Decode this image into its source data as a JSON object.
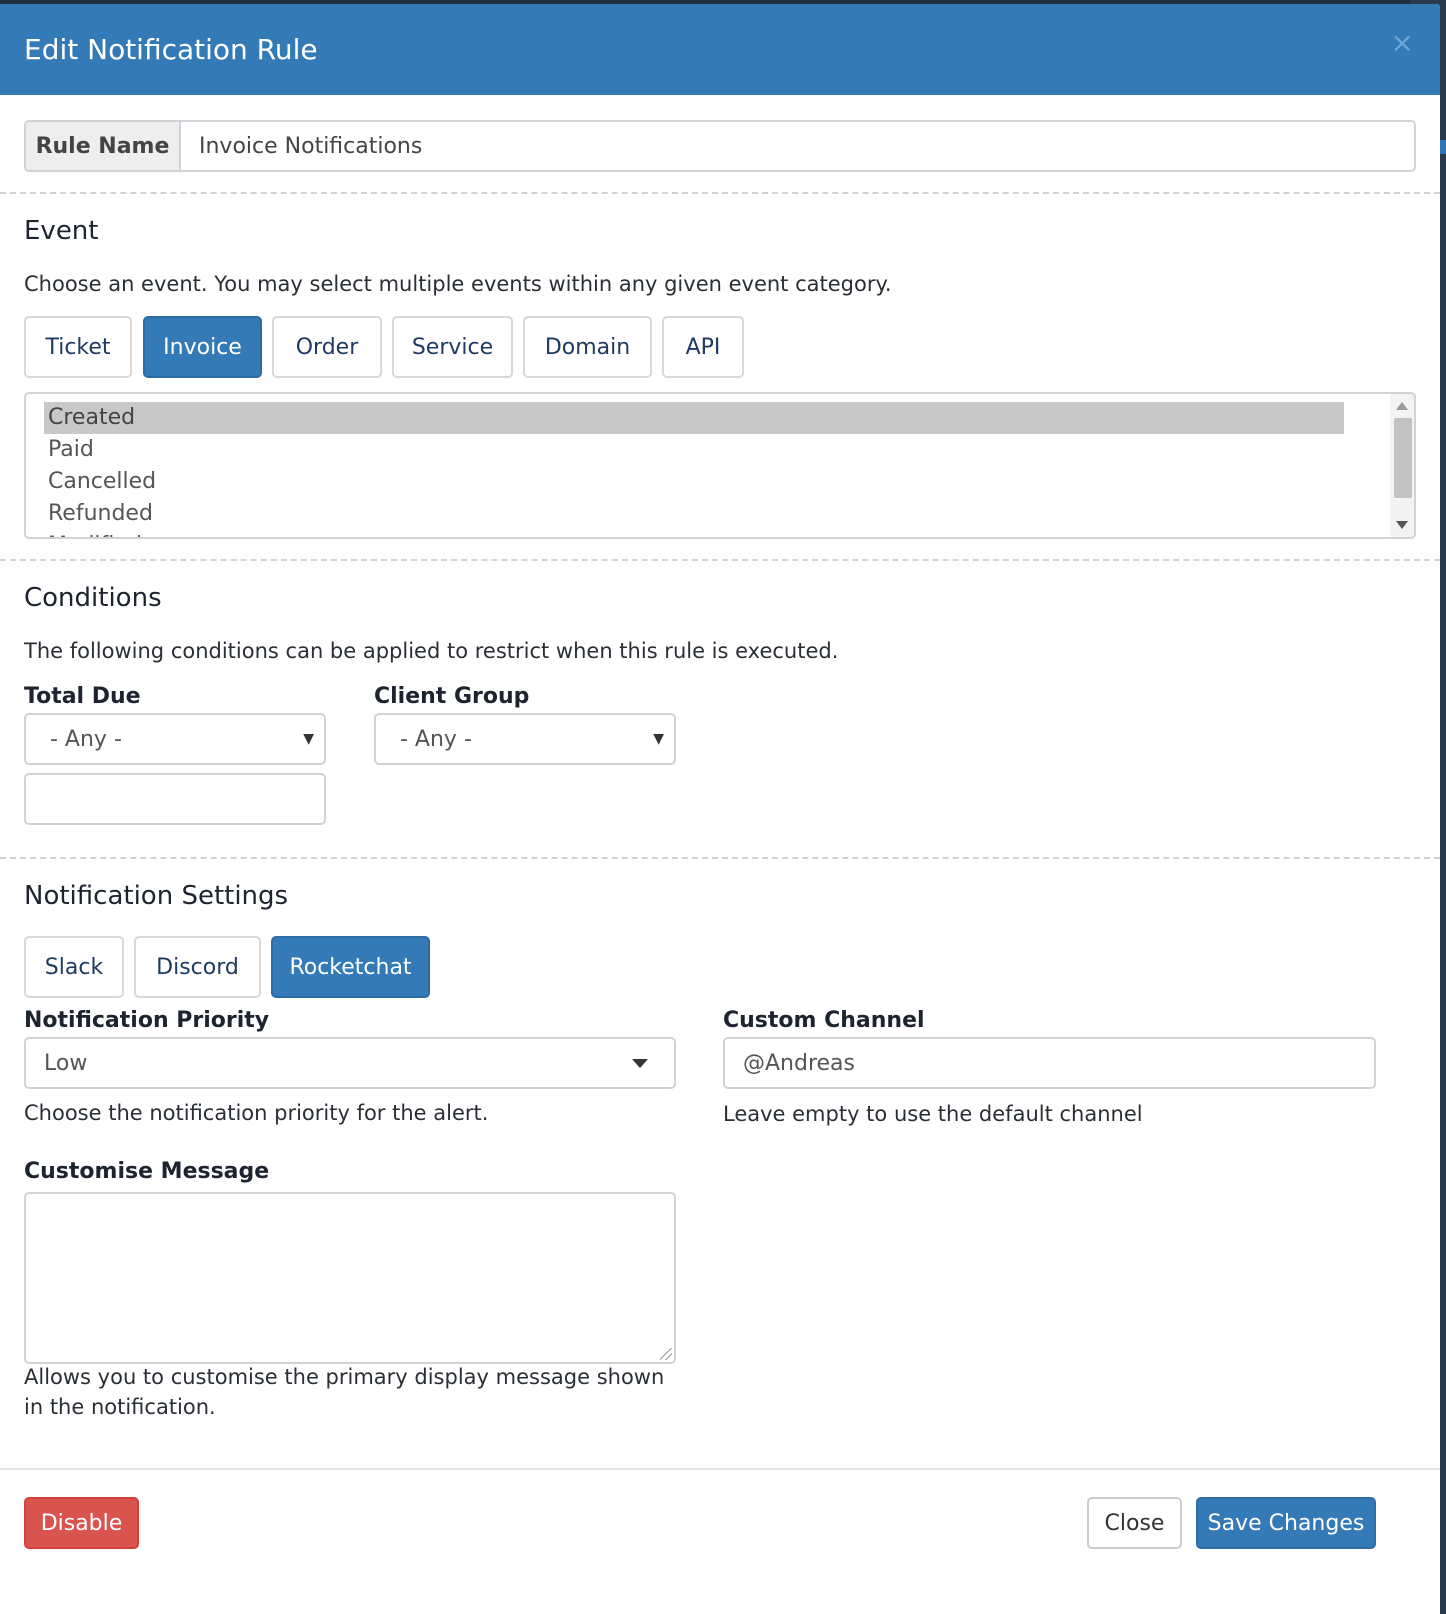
{
  "modal": {
    "title": "Edit Notification Rule",
    "close_symbol": "×"
  },
  "rule_name": {
    "label": "Rule Name",
    "value": "Invoice Notifications"
  },
  "event": {
    "title": "Event",
    "description": "Choose an event. You may select multiple events within any given event category.",
    "categories": [
      {
        "label": "Ticket",
        "active": false
      },
      {
        "label": "Invoice",
        "active": true
      },
      {
        "label": "Order",
        "active": false
      },
      {
        "label": "Service",
        "active": false
      },
      {
        "label": "Domain",
        "active": false
      },
      {
        "label": "API",
        "active": false
      }
    ],
    "items": [
      {
        "label": "Created",
        "selected": true
      },
      {
        "label": "Paid",
        "selected": false
      },
      {
        "label": "Cancelled",
        "selected": false
      },
      {
        "label": "Refunded",
        "selected": false
      },
      {
        "label": "Modified",
        "selected": false
      }
    ]
  },
  "conditions": {
    "title": "Conditions",
    "description": "The following conditions can be applied to restrict when this rule is executed.",
    "total_due": {
      "label": "Total Due",
      "selected": "- Any -",
      "value": ""
    },
    "client_group": {
      "label": "Client Group",
      "selected": "- Any -"
    }
  },
  "notification_settings": {
    "title": "Notification Settings",
    "providers": [
      {
        "label": "Slack",
        "active": false
      },
      {
        "label": "Discord",
        "active": false
      },
      {
        "label": "Rocketchat",
        "active": true
      }
    ],
    "priority": {
      "label": "Notification Priority",
      "selected": "Low",
      "help": "Choose the notification priority for the alert."
    },
    "custom_channel": {
      "label": "Custom Channel",
      "value": "@Andreas",
      "help": "Leave empty to use the default channel"
    },
    "message": {
      "label": "Customise Message",
      "value": "",
      "help": "Allows you to customise the primary display message shown in the notification."
    }
  },
  "footer": {
    "disable_label": "Disable",
    "close_label": "Close",
    "save_label": "Save Changes"
  },
  "colors": {
    "primary": "#337ab7",
    "danger": "#d9534f"
  }
}
